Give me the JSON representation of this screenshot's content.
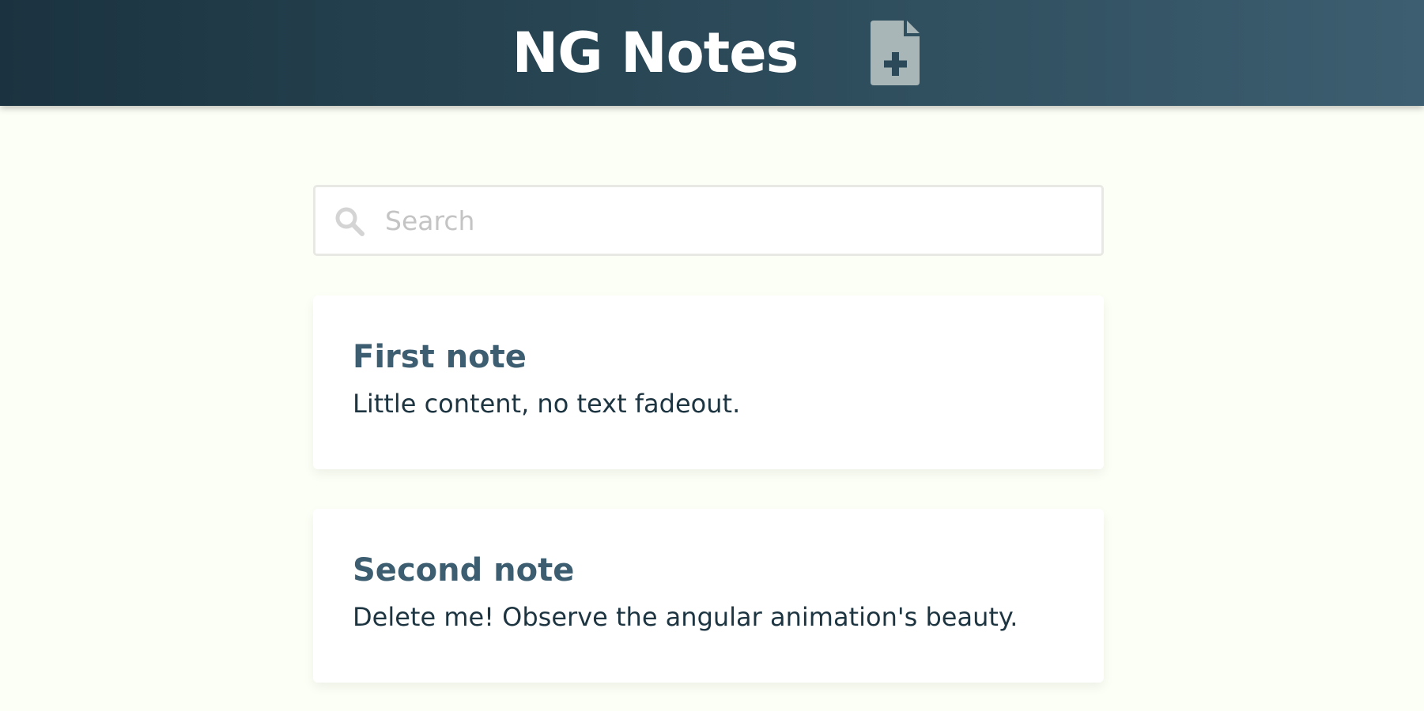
{
  "header": {
    "title": "NG Notes",
    "new_note_icon": "file-plus-icon"
  },
  "search": {
    "placeholder": "Search",
    "value": "",
    "icon": "search-icon"
  },
  "notes": [
    {
      "title": "First note",
      "body": "Little content, no text fadeout."
    },
    {
      "title": "Second note",
      "body": "Delete me! Observe the angular animation's beauty."
    }
  ],
  "colors": {
    "header_gradient_start": "#1b3340",
    "header_gradient_end": "#3c5e70",
    "background": "#fcfff5",
    "note_title": "#3c5e70",
    "note_body": "#1d3441",
    "icon_fill": "#a9b6b8"
  }
}
